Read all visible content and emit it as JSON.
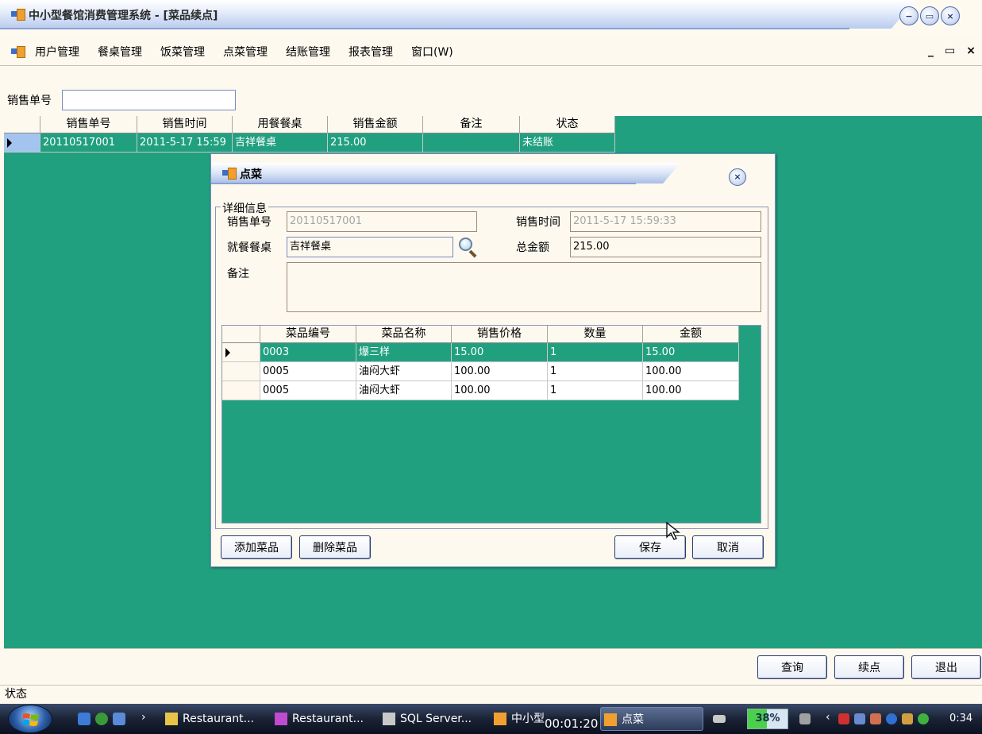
{
  "window": {
    "title": "中小型餐馆消费管理系统 - [菜品续点]",
    "btn_min": "−",
    "btn_restore": "▭",
    "btn_close": "×"
  },
  "menu": {
    "items": [
      "用户管理",
      "餐桌管理",
      "饭菜管理",
      "点菜管理",
      "结账管理",
      "报表管理",
      "窗口(W)"
    ],
    "mdi_min": "_",
    "mdi_restore": "▭",
    "mdi_close": "×"
  },
  "search": {
    "label": "销售单号",
    "value": ""
  },
  "main_grid": {
    "headers": [
      "销售单号",
      "销售时间",
      "用餐餐桌",
      "销售金额",
      "备注",
      "状态"
    ],
    "rows": [
      [
        "20110517001",
        "2011-5-17 15:59",
        "吉祥餐桌",
        "215.00",
        "",
        "未结账"
      ]
    ]
  },
  "dialog": {
    "title": "点菜",
    "close": "×",
    "group_label": "详细信息",
    "sale_no_label": "销售单号",
    "sale_no_value": "20110517001",
    "sale_time_label": "销售时间",
    "sale_time_value": "2011-5-17 15:59:33",
    "table_label": "就餐餐桌",
    "table_value": "吉祥餐桌",
    "total_label": "总金额",
    "total_value": "215.00",
    "note_label": "备注",
    "note_value": "",
    "grid": {
      "headers": [
        "菜品编号",
        "菜品名称",
        "销售价格",
        "数量",
        "金额"
      ],
      "rows": [
        [
          "0003",
          "爆三样",
          "15.00",
          "1",
          "15.00"
        ],
        [
          "0005",
          "油闷大虾",
          "100.00",
          "1",
          "100.00"
        ],
        [
          "0005",
          "油闷大虾",
          "100.00",
          "1",
          "100.00"
        ]
      ]
    },
    "btn_add": "添加菜品",
    "btn_delete": "删除菜品",
    "btn_save": "保存",
    "btn_cancel": "取消"
  },
  "bottom": {
    "btn_query": "查询",
    "btn_continue": "续点",
    "btn_exit": "退出"
  },
  "status_bar": {
    "text": "状态"
  },
  "taskbar": {
    "items": [
      {
        "label": "Restaurant...",
        "icon": "folder-icon"
      },
      {
        "label": "Restaurant...",
        "icon": "visual-studio-icon"
      },
      {
        "label": "SQL Server...",
        "icon": "sql-server-icon"
      },
      {
        "label": "中小型",
        "icon": "app-icon"
      },
      {
        "label": "点菜",
        "icon": "app-icon"
      }
    ],
    "timer": "00:01:20",
    "battery": "38%",
    "clock": "0:34",
    "more_arrow": "›",
    "tray_arrow": "‹"
  },
  "colors": {
    "grid_green": "#21a080",
    "selection_blue": "#a4c4f0",
    "form_background": "#fdf9ef"
  }
}
